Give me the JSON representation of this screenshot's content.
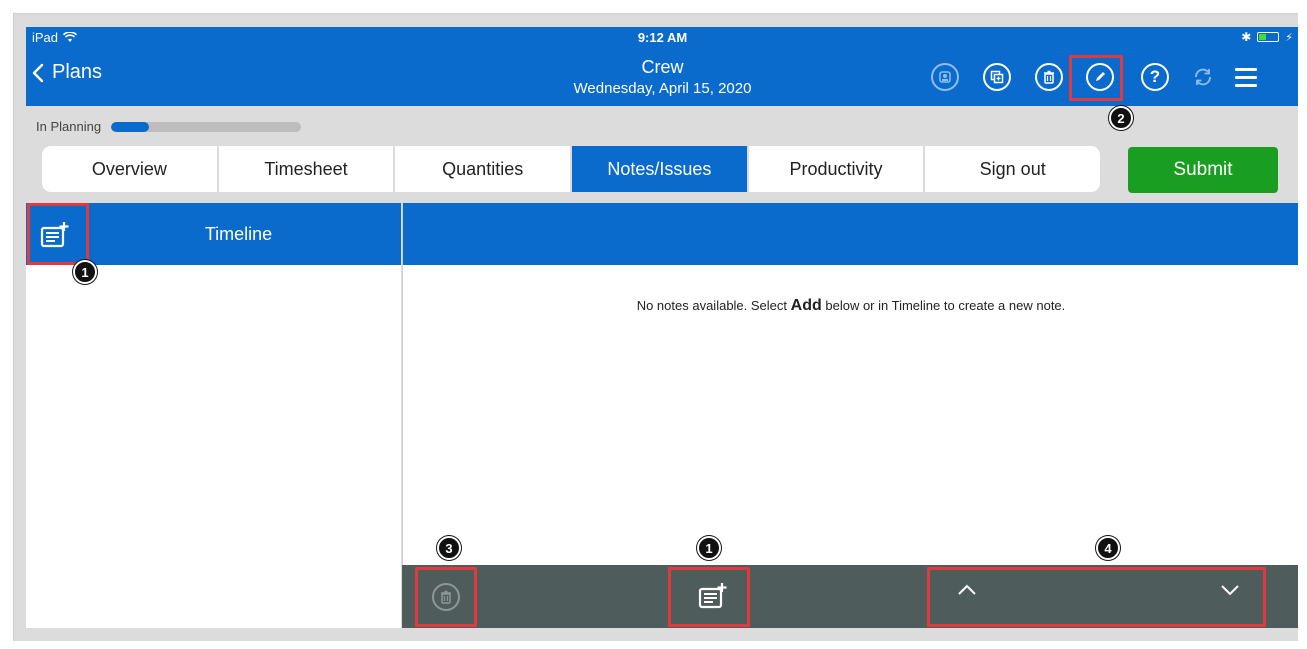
{
  "status_bar": {
    "device": "iPad",
    "time": "9:12 AM"
  },
  "nav": {
    "back_label": "Plans",
    "title": "Crew",
    "subtitle": "Wednesday, April 15, 2020",
    "icons": [
      "user-doc-icon",
      "copy-icon",
      "trash-icon",
      "edit-pencil-icon",
      "help-icon",
      "sync-icon",
      "menu-icon"
    ],
    "help_glyph": "?"
  },
  "progress": {
    "label": "In Planning",
    "percent": 20
  },
  "tabs": [
    {
      "label": "Overview",
      "active": false
    },
    {
      "label": "Timesheet",
      "active": false
    },
    {
      "label": "Quantities",
      "active": false
    },
    {
      "label": "Notes/Issues",
      "active": true
    },
    {
      "label": "Productivity",
      "active": false
    },
    {
      "label": "Sign out",
      "active": false
    }
  ],
  "submit_label": "Submit",
  "timeline": {
    "title": "Timeline"
  },
  "notes": {
    "empty_prefix": "No notes available. Select ",
    "empty_bold": "Add",
    "empty_suffix": " below or in Timeline to create a new note."
  },
  "callouts": [
    "1",
    "2",
    "3",
    "1",
    "4"
  ],
  "colors": {
    "primary": "#0a6bcd",
    "submit": "#1a9e22",
    "callout": "#e0393e",
    "bottom_bar": "#4f5c5c"
  }
}
